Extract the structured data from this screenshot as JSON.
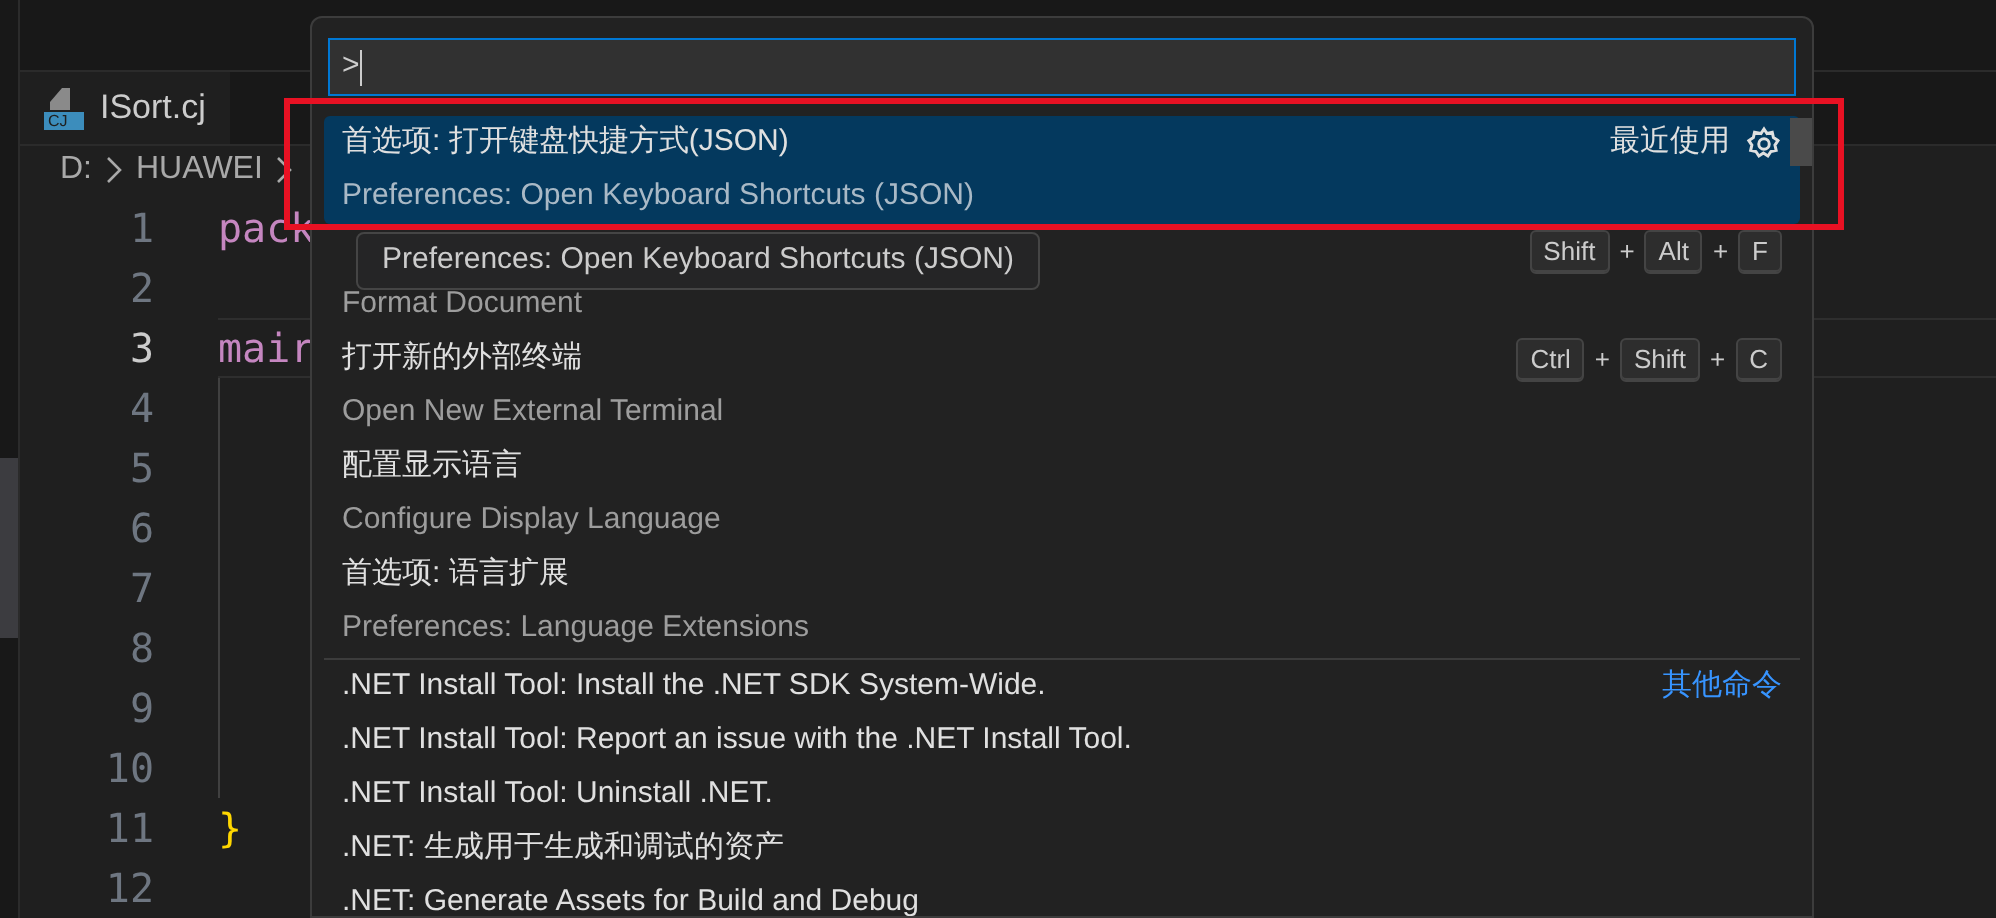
{
  "editor": {
    "tab": {
      "label": "ISort.cj",
      "icon_text": "CJ"
    },
    "breadcrumb": [
      "D:",
      "HUAWEI"
    ],
    "lines": [
      {
        "number": "1",
        "code": "pack",
        "current": false,
        "color": "#c586c0"
      },
      {
        "number": "2",
        "current": false
      },
      {
        "number": "3",
        "code": "mair",
        "current": true,
        "color": "#c586c0"
      },
      {
        "number": "4",
        "current": false
      },
      {
        "number": "5",
        "current": false
      },
      {
        "number": "6",
        "current": false
      },
      {
        "number": "7",
        "current": false
      },
      {
        "number": "8",
        "current": false
      },
      {
        "number": "9",
        "current": false
      },
      {
        "number": "10",
        "current": false
      },
      {
        "number": "11",
        "code": "}",
        "current": false,
        "color": "#ffd700"
      },
      {
        "number": "12",
        "current": false
      }
    ]
  },
  "command_palette": {
    "input": {
      "value": ">"
    },
    "key_separator": "+",
    "items": [
      {
        "label": "首选项: 打开键盘快捷方式(JSON)",
        "detail": "Preferences: Open Keyboard Shortcuts (JSON)",
        "badge": "最近使用",
        "selected": true
      },
      {
        "detail": "Format Document",
        "keys": [
          "Shift",
          "Alt",
          "F"
        ],
        "selected": false
      },
      {
        "label": "打开新的外部终端",
        "detail": "Open New External Terminal",
        "keys": [
          "Ctrl",
          "Shift",
          "C"
        ],
        "selected": false
      },
      {
        "label": "配置显示语言",
        "detail": "Configure Display Language",
        "selected": false
      },
      {
        "label": "首选项: 语言扩展",
        "detail": "Preferences: Language Extensions",
        "selected": false
      }
    ],
    "other_group": {
      "heading": "其他命令",
      "items": [
        {
          "label": ".NET Install Tool: Install the .NET SDK System-Wide.",
          "selected": false
        },
        {
          "label": ".NET Install Tool: Report an issue with the .NET Install Tool.",
          "selected": false
        },
        {
          "label": ".NET Install Tool: Uninstall .NET.",
          "selected": false
        },
        {
          "label": ".NET: 生成用于生成和调试的资产",
          "selected": false
        },
        {
          "label": ".NET: Generate Assets for Build and Debug",
          "selected": false
        }
      ]
    },
    "tooltip": "Preferences: Open Keyboard Shortcuts (JSON)"
  }
}
